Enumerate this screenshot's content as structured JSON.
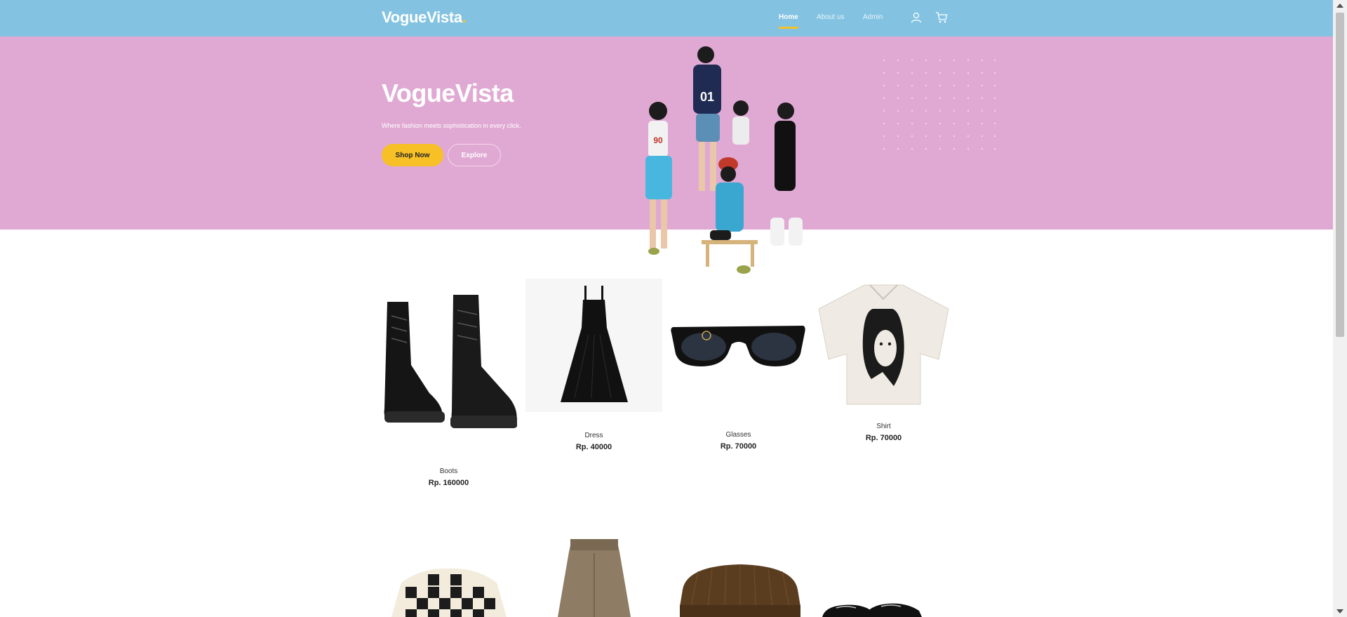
{
  "nav": {
    "brand": "VogueVista",
    "brand_dot": ".",
    "links": [
      "Home",
      "About us",
      "Admin"
    ],
    "active": "Home",
    "icons": [
      "user-icon",
      "cart-icon"
    ]
  },
  "hero": {
    "title": "VogueVista",
    "subtitle": "Where fashion meets sophistication in every click.",
    "primary_button": "Shop Now",
    "secondary_button": "Explore"
  },
  "products": [
    {
      "name": "Boots",
      "price": "Rp. 160000"
    },
    {
      "name": "Dress",
      "price": "Rp. 40000"
    },
    {
      "name": "Glasses",
      "price": "Rp. 70000"
    },
    {
      "name": "Shirt",
      "price": "Rp. 70000"
    }
  ],
  "products_row2": [
    {
      "image": "checkered-jacket"
    },
    {
      "image": "trousers"
    },
    {
      "image": "hat"
    },
    {
      "image": "loafers"
    }
  ],
  "colors": {
    "navbar": "#83c3e1",
    "hero": "#e0a9d3",
    "accent": "#f6c026"
  }
}
